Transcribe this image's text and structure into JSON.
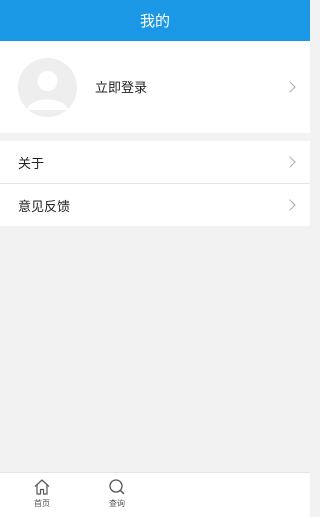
{
  "header": {
    "title": "我的"
  },
  "profile": {
    "login_label": "立即登录",
    "avatar_icon": "user-avatar-icon"
  },
  "menu": {
    "items": [
      {
        "label": "关于"
      },
      {
        "label": "意见反馈"
      }
    ]
  },
  "tabbar": {
    "tabs": [
      {
        "label": "首页",
        "icon": "home-icon"
      },
      {
        "label": "查询",
        "icon": "search-icon"
      }
    ]
  },
  "colors": {
    "header_bg": "#1a98e6",
    "page_bg": "#f2f2f2"
  }
}
